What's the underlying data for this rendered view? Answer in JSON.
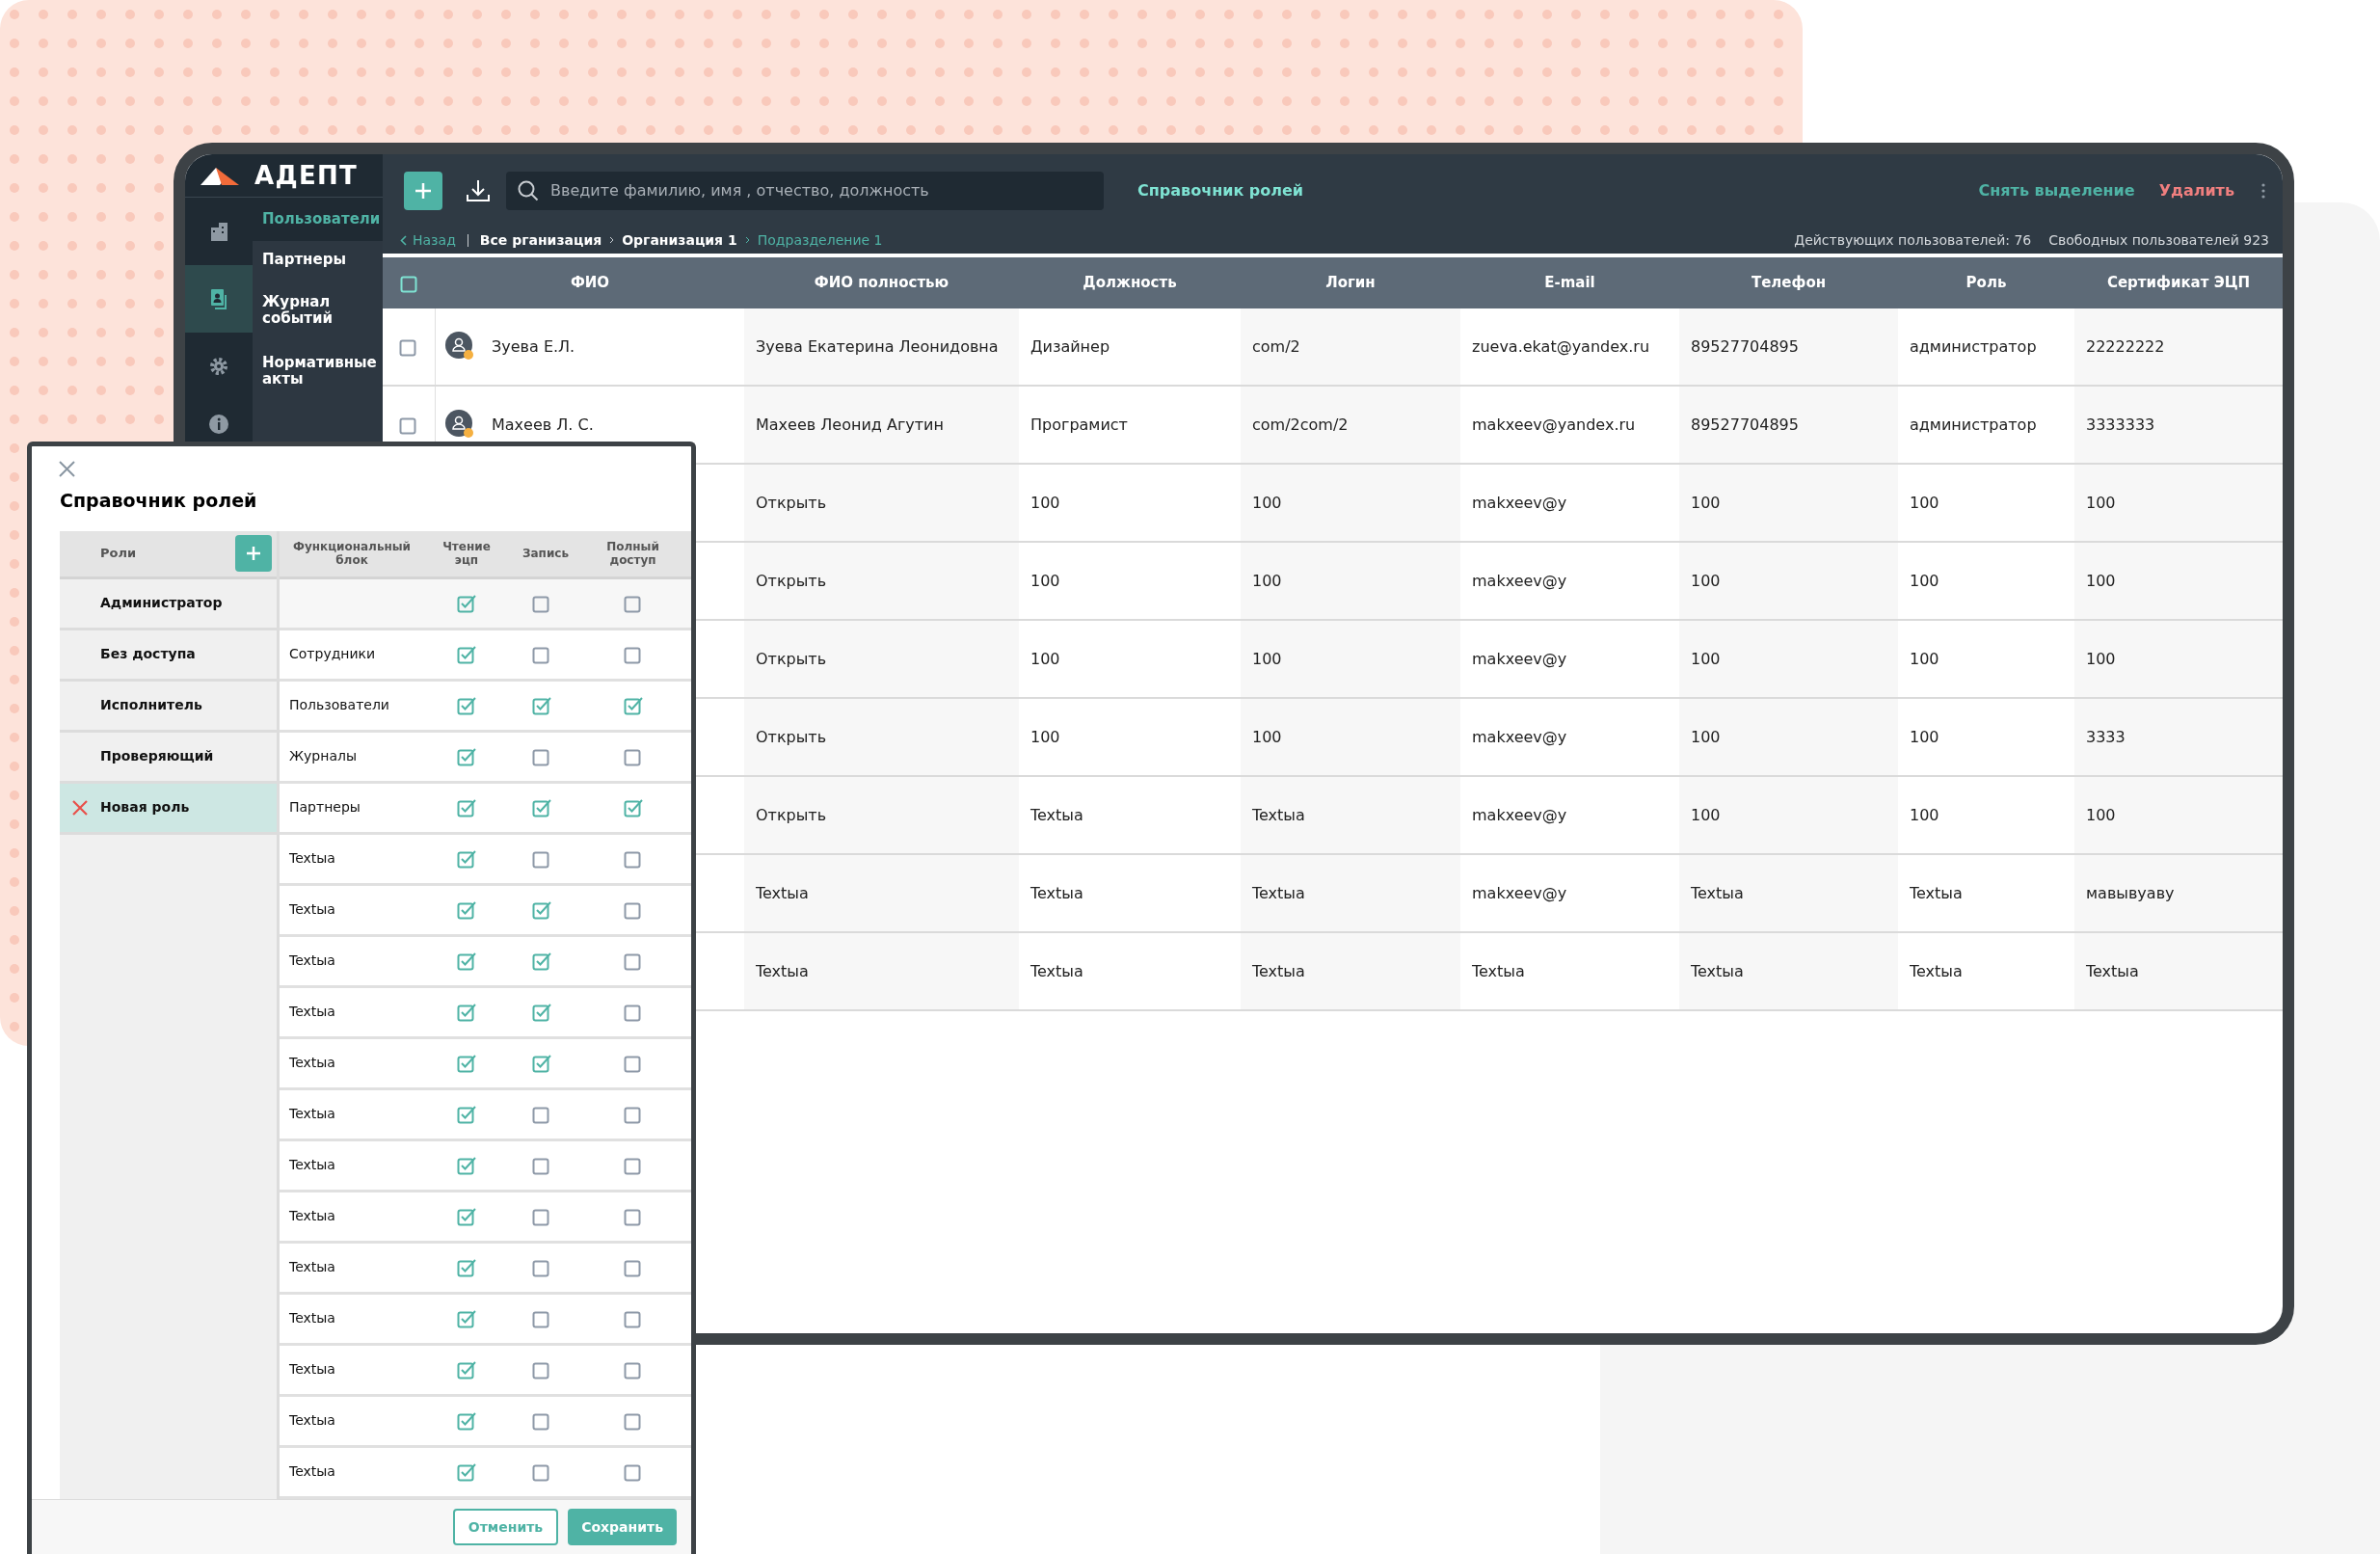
{
  "sidebar": {
    "logo": "АДЕПТ",
    "icon_tabs": [
      {
        "selected": false
      },
      {
        "selected": true
      },
      {
        "selected": false
      },
      {
        "selected": false
      }
    ],
    "items": [
      {
        "label": "Пользователи",
        "selected": true
      },
      {
        "label": "Партнеры",
        "selected": false
      },
      {
        "label": "Журнал событий",
        "selected": false
      },
      {
        "label": "Нормативные акты",
        "selected": false
      }
    ]
  },
  "toolbar": {
    "search": {
      "placeholder": "Введите фамилию, имя , отчество, должность"
    },
    "link": "Справочник ролей",
    "actions": [
      {
        "label": "Снять выделение",
        "kind": "primary"
      },
      {
        "label": "Удалить",
        "kind": "danger"
      }
    ]
  },
  "breadcrumb": {
    "back": "Назад",
    "items": [
      {
        "label": "Все рганизация",
        "selected": false
      },
      {
        "label": "Организация 1",
        "selected": false
      },
      {
        "label": "Подразделение 1",
        "selected": true
      }
    ]
  },
  "stats": [
    "Действующих пользователей: 76",
    "Свободных пользователей 923"
  ],
  "table": {
    "header_checkbox": {
      "checked": false
    },
    "columns": [
      "ФИО",
      "ФИО полностью",
      "Должность",
      "Логин",
      "E-mail",
      "Телефон",
      "Роль",
      "Сертификат ЭЦП"
    ],
    "rows": [
      {
        "checked": false,
        "fio": "Зуева Е.Л.",
        "cells": [
          "Зуева Екатерина Леонидовна",
          "Дизайнер",
          "com/2",
          "zueva.ekat@yandex.ru",
          "89527704895",
          "администратор",
          "22222222"
        ]
      },
      {
        "checked": false,
        "fio": "Махеев Л. С.",
        "cells": [
          "Махеев Леонид Агутин",
          "Програмист",
          "com/2com/2",
          "makxeev@yandex.ru",
          "89527704895",
          "администратор",
          "3333333"
        ]
      },
      {
        "cells": [
          "Открыть",
          "100",
          "100",
          "makxeev@y",
          "100",
          "100",
          "100"
        ]
      },
      {
        "cells": [
          "Открыть",
          "100",
          "100",
          "makxeev@y",
          "100",
          "100",
          "100"
        ]
      },
      {
        "cells": [
          "Открыть",
          "100",
          "100",
          "makxeev@y",
          "100",
          "100",
          "100"
        ]
      },
      {
        "cells": [
          "Открыть",
          "100",
          "100",
          "makxeev@y",
          "100",
          "100",
          "3333"
        ]
      },
      {
        "cells": [
          "Открыть",
          "Textыa",
          "Textыa",
          "makxeev@y",
          "100",
          "100",
          "100"
        ]
      },
      {
        "cells": [
          "Textыa",
          "Textыa",
          "Textыa",
          "makxeev@y",
          "Textыa",
          "Textыa",
          "мавывуаву"
        ]
      },
      {
        "cells": [
          "Textыa",
          "Textыa",
          "Textыa",
          "Textыa",
          "Textыa",
          "Textыa",
          "Textыa"
        ]
      }
    ]
  },
  "modal": {
    "title": "Справочник ролей",
    "columns": [
      "Роли",
      "Функциональный блок",
      "Чтение эцп",
      "Запись",
      "Полный доступ"
    ],
    "roles": [
      {
        "name": "Администратор",
        "selected": false
      },
      {
        "name": "Без доступа",
        "selected": false
      },
      {
        "name": "Исполнитель",
        "selected": false
      },
      {
        "name": "Проверяющий",
        "selected": false
      },
      {
        "name": "Новая роль",
        "selected": true
      }
    ],
    "permissions": [
      {
        "read": true,
        "write": false,
        "full": false
      },
      {
        "block": "Сотрудники",
        "read": true,
        "write": false,
        "full": false
      },
      {
        "block": "Пользователи",
        "read": true,
        "write": true,
        "full": true
      },
      {
        "block": "Журналы",
        "read": true,
        "write": false,
        "full": false
      },
      {
        "block": "Партнеры",
        "read": true,
        "write": true,
        "full": true
      },
      {
        "block": "Textыa",
        "read": true,
        "write": false,
        "full": false
      },
      {
        "block": "Textыa",
        "read": true,
        "write": true,
        "full": false
      },
      {
        "block": "Textыa",
        "read": true,
        "write": true,
        "full": false
      },
      {
        "block": "Textыa",
        "read": true,
        "write": true,
        "full": false
      },
      {
        "block": "Textыa",
        "read": true,
        "write": true,
        "full": false
      },
      {
        "block": "Textыa",
        "read": true,
        "write": false,
        "full": false
      },
      {
        "block": "Textыa",
        "read": true,
        "write": false,
        "full": false
      },
      {
        "block": "Textыa",
        "read": true,
        "write": false,
        "full": false
      },
      {
        "block": "Textыa",
        "read": true,
        "write": false,
        "full": false
      },
      {
        "block": "Textыa",
        "read": true,
        "write": false,
        "full": false
      },
      {
        "block": "Textыa",
        "read": true,
        "write": false,
        "full": false
      },
      {
        "block": "Textыa",
        "read": true,
        "write": false,
        "full": false
      },
      {
        "block": "Textыa",
        "read": true,
        "write": false,
        "full": false
      }
    ],
    "buttons": [
      {
        "label": "Отменить",
        "kind": "secondary"
      },
      {
        "label": "Сохранить",
        "kind": "primary"
      }
    ]
  }
}
